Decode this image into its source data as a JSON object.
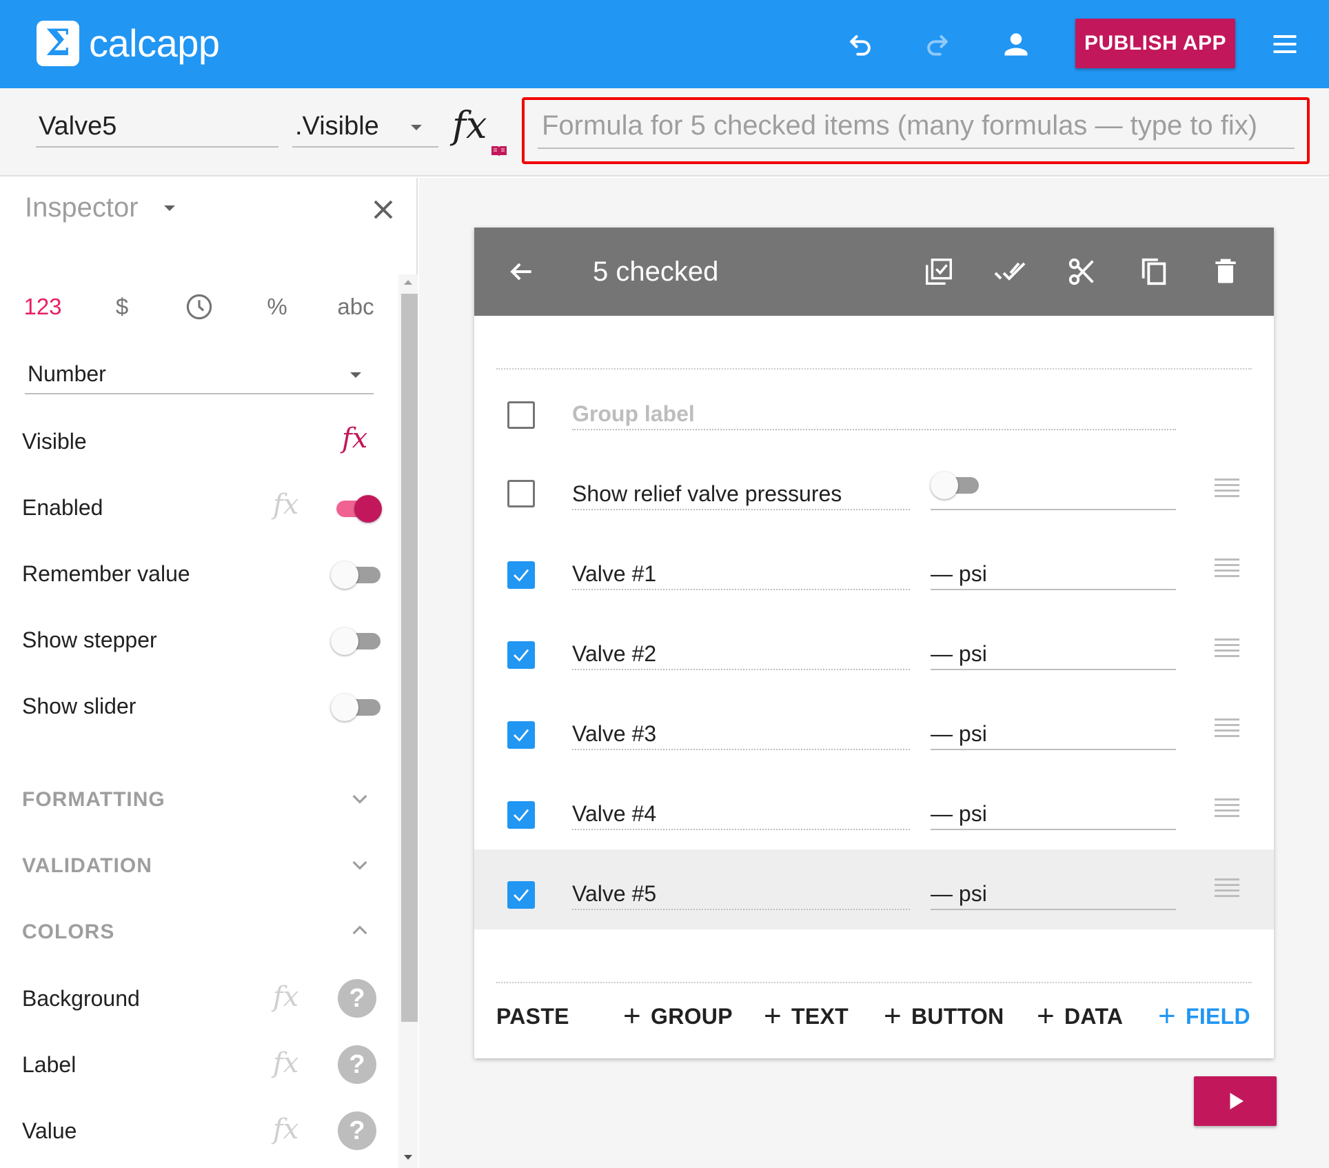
{
  "header": {
    "logo_glyph": "Σ",
    "app_name": "calcapp",
    "publish_label": "PUBLISH APP",
    "icons": [
      "undo-icon",
      "redo-icon",
      "account-icon",
      "menu-icon"
    ],
    "accent_color": "#2196f3",
    "publish_color": "#c2185b"
  },
  "formula_bar": {
    "name_value": "Valve5",
    "property_value": ".Visible",
    "fx_label": "fx",
    "formula_placeholder": "Formula for 5 checked items (many formulas — type to fix)"
  },
  "inspector": {
    "title": "Inspector",
    "type_tabs": [
      "123",
      "$",
      "clock-icon",
      "%",
      "abc"
    ],
    "type_select": "Number",
    "props": [
      {
        "label": "Visible",
        "fx_active": true
      },
      {
        "label": "Enabled",
        "toggle": true
      },
      {
        "label": "Remember value",
        "toggle": false
      },
      {
        "label": "Show stepper",
        "toggle": false
      },
      {
        "label": "Show slider",
        "toggle": false
      }
    ],
    "sections": [
      {
        "label": "FORMATTING",
        "expanded": false
      },
      {
        "label": "VALIDATION",
        "expanded": false
      },
      {
        "label": "COLORS",
        "expanded": true
      }
    ],
    "color_props": [
      "Background",
      "Label",
      "Value"
    ],
    "help_glyph": "?",
    "fx_label": "fx"
  },
  "card": {
    "toolbar_title": "5 checked",
    "toolbar_icons": [
      "back-arrow-icon",
      "select-all-icon",
      "double-check-icon",
      "scissors-icon",
      "copy-icon",
      "delete-icon"
    ],
    "group_placeholder": "Group label",
    "rows": [
      {
        "label": "Show relief valve pressures",
        "value": "",
        "checked": false,
        "toggle": true
      },
      {
        "label": "Valve #1",
        "value": "— psi",
        "checked": true
      },
      {
        "label": "Valve #2",
        "value": "— psi",
        "checked": true
      },
      {
        "label": "Valve #3",
        "value": "— psi",
        "checked": true
      },
      {
        "label": "Valve #4",
        "value": "— psi",
        "checked": true
      },
      {
        "label": "Valve #5",
        "value": "— psi",
        "checked": true
      }
    ],
    "actions": {
      "paste": "PASTE",
      "group": "GROUP",
      "text": "TEXT",
      "button": "BUTTON",
      "data": "DATA",
      "field": "FIELD",
      "plus": "+"
    }
  },
  "run_button": {
    "icon": "play-icon"
  }
}
